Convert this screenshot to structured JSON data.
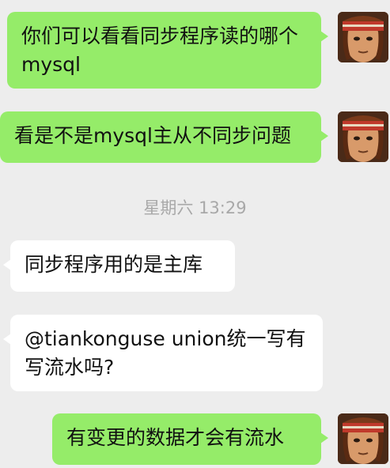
{
  "chat": {
    "timestamp": "星期六 13:29",
    "messages": [
      {
        "side": "out",
        "text": "你们可以看看同步程序读的哪个mysql"
      },
      {
        "side": "out",
        "text": "看是不是mysql主从不同步问题"
      },
      {
        "side": "in",
        "text": "同步程序用的是主库"
      },
      {
        "side": "in",
        "text": "@tiankonguse union统一写有写流水吗?"
      },
      {
        "side": "out",
        "text": "有变更的数据才会有流水"
      }
    ]
  },
  "avatar": {
    "icon": "cartoon-pirate-avatar-icon"
  },
  "colors": {
    "background": "#ededed",
    "outgoing_bubble": "#95ec69",
    "incoming_bubble": "#ffffff",
    "timestamp_text": "#a8a8a8"
  }
}
